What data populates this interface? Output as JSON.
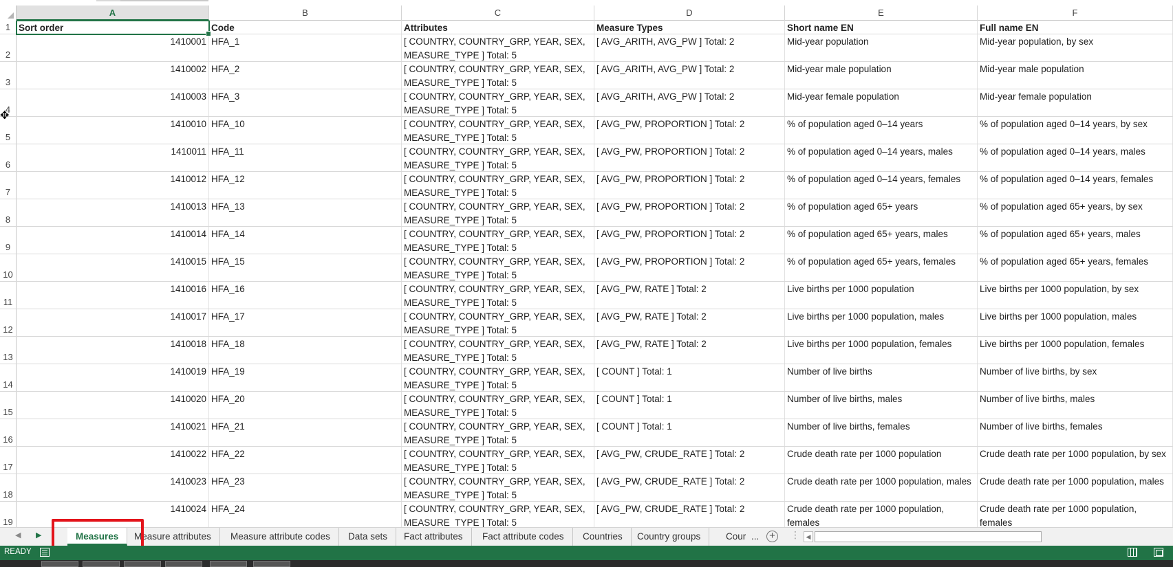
{
  "columns": [
    {
      "letter": "A",
      "selected": true
    },
    {
      "letter": "B",
      "selected": false
    },
    {
      "letter": "C",
      "selected": false
    },
    {
      "letter": "D",
      "selected": false
    },
    {
      "letter": "E",
      "selected": false
    },
    {
      "letter": "F",
      "selected": false
    }
  ],
  "header_row": {
    "num": "1",
    "cells": [
      "Sort order",
      "Code",
      "Attributes",
      "Measure Types",
      "Short name EN",
      "Full name EN"
    ]
  },
  "rows": [
    {
      "num": "2",
      "sort": "1410001",
      "code": "HFA_1",
      "attr": "[ COUNTRY, COUNTRY_GRP, YEAR, SEX, MEASURE_TYPE ] Total: 5",
      "types": "[ AVG_ARITH, AVG_PW ] Total: 2",
      "short": "Mid-year population",
      "full": "Mid-year population, by sex"
    },
    {
      "num": "3",
      "sort": "1410002",
      "code": "HFA_2",
      "attr": "[ COUNTRY, COUNTRY_GRP, YEAR, SEX, MEASURE_TYPE ] Total: 5",
      "types": "[ AVG_ARITH, AVG_PW ] Total: 2",
      "short": "Mid-year male population",
      "full": "Mid-year male population"
    },
    {
      "num": "4",
      "sort": "1410003",
      "code": "HFA_3",
      "attr": "[ COUNTRY, COUNTRY_GRP, YEAR, SEX, MEASURE_TYPE ] Total: 5",
      "types": "[ AVG_ARITH, AVG_PW ] Total: 2",
      "short": "Mid-year female population",
      "full": "Mid-year female population"
    },
    {
      "num": "5",
      "sort": "1410010",
      "code": "HFA_10",
      "attr": "[ COUNTRY, COUNTRY_GRP, YEAR, SEX, MEASURE_TYPE ] Total: 5",
      "types": "[ AVG_PW, PROPORTION ] Total: 2",
      "short": "% of population aged 0–14 years",
      "full": "% of population aged 0–14 years, by sex"
    },
    {
      "num": "6",
      "sort": "1410011",
      "code": "HFA_11",
      "attr": "[ COUNTRY, COUNTRY_GRP, YEAR, SEX, MEASURE_TYPE ] Total: 5",
      "types": "[ AVG_PW, PROPORTION ] Total: 2",
      "short": "% of population aged 0–14 years, males",
      "full": "% of population aged 0–14 years, males"
    },
    {
      "num": "7",
      "sort": "1410012",
      "code": "HFA_12",
      "attr": "[ COUNTRY, COUNTRY_GRP, YEAR, SEX, MEASURE_TYPE ] Total: 5",
      "types": "[ AVG_PW, PROPORTION ] Total: 2",
      "short": "% of population aged 0–14 years, females",
      "full": "% of population aged 0–14 years, females"
    },
    {
      "num": "8",
      "sort": "1410013",
      "code": "HFA_13",
      "attr": "[ COUNTRY, COUNTRY_GRP, YEAR, SEX, MEASURE_TYPE ] Total: 5",
      "types": "[ AVG_PW, PROPORTION ] Total: 2",
      "short": "% of population aged 65+ years",
      "full": "% of population aged 65+ years, by sex"
    },
    {
      "num": "9",
      "sort": "1410014",
      "code": "HFA_14",
      "attr": "[ COUNTRY, COUNTRY_GRP, YEAR, SEX, MEASURE_TYPE ] Total: 5",
      "types": "[ AVG_PW, PROPORTION ] Total: 2",
      "short": "% of population aged 65+ years, males",
      "full": "% of population aged 65+ years, males"
    },
    {
      "num": "10",
      "sort": "1410015",
      "code": "HFA_15",
      "attr": "[ COUNTRY, COUNTRY_GRP, YEAR, SEX, MEASURE_TYPE ] Total: 5",
      "types": "[ AVG_PW, PROPORTION ] Total: 2",
      "short": "% of population aged 65+ years, females",
      "full": "% of population aged 65+ years, females"
    },
    {
      "num": "11",
      "sort": "1410016",
      "code": "HFA_16",
      "attr": "[ COUNTRY, COUNTRY_GRP, YEAR, SEX, MEASURE_TYPE ] Total: 5",
      "types": "[ AVG_PW, RATE ] Total: 2",
      "short": "Live births per 1000 population",
      "full": "Live births per 1000 population, by sex"
    },
    {
      "num": "12",
      "sort": "1410017",
      "code": "HFA_17",
      "attr": "[ COUNTRY, COUNTRY_GRP, YEAR, SEX, MEASURE_TYPE ] Total: 5",
      "types": "[ AVG_PW, RATE ] Total: 2",
      "short": "Live births per 1000 population, males",
      "full": "Live births per 1000 population, males"
    },
    {
      "num": "13",
      "sort": "1410018",
      "code": "HFA_18",
      "attr": "[ COUNTRY, COUNTRY_GRP, YEAR, SEX, MEASURE_TYPE ] Total: 5",
      "types": "[ AVG_PW, RATE ] Total: 2",
      "short": "Live births per 1000 population, females",
      "full": "Live births per 1000 population, females"
    },
    {
      "num": "14",
      "sort": "1410019",
      "code": "HFA_19",
      "attr": "[ COUNTRY, COUNTRY_GRP, YEAR, SEX, MEASURE_TYPE ] Total: 5",
      "types": "[ COUNT ] Total: 1",
      "short": "Number of live births",
      "full": "Number of live births, by sex"
    },
    {
      "num": "15",
      "sort": "1410020",
      "code": "HFA_20",
      "attr": "[ COUNTRY, COUNTRY_GRP, YEAR, SEX, MEASURE_TYPE ] Total: 5",
      "types": "[ COUNT ] Total: 1",
      "short": "Number of live births, males",
      "full": "Number of live births, males"
    },
    {
      "num": "16",
      "sort": "1410021",
      "code": "HFA_21",
      "attr": "[ COUNTRY, COUNTRY_GRP, YEAR, SEX, MEASURE_TYPE ] Total: 5",
      "types": "[ COUNT ] Total: 1",
      "short": "Number of live births, females",
      "full": "Number of live births, females"
    },
    {
      "num": "17",
      "sort": "1410022",
      "code": "HFA_22",
      "attr": "[ COUNTRY, COUNTRY_GRP, YEAR, SEX, MEASURE_TYPE ] Total: 5",
      "types": "[ AVG_PW, CRUDE_RATE ] Total: 2",
      "short": "Crude death rate per 1000 population",
      "full": "Crude death rate per 1000 population, by sex"
    },
    {
      "num": "18",
      "sort": "1410023",
      "code": "HFA_23",
      "attr": "[ COUNTRY, COUNTRY_GRP, YEAR, SEX, MEASURE_TYPE ] Total: 5",
      "types": "[ AVG_PW, CRUDE_RATE ] Total: 2",
      "short": "Crude death rate per 1000 population, males",
      "full": "Crude death rate per 1000 population, males"
    },
    {
      "num": "19",
      "sort": "1410024",
      "code": "HFA_24",
      "attr": "[ COUNTRY, COUNTRY_GRP, YEAR, SEX, MEASURE_TYPE ] Total: 5",
      "types": "[ AVG_PW, CRUDE_RATE ] Total: 2",
      "short": "Crude death rate per 1000 population, females",
      "full": "Crude death rate per 1000 population, females"
    }
  ],
  "sheet_tabs": [
    {
      "label": "Measures",
      "active": true
    },
    {
      "label": "Measure attributes",
      "active": false
    },
    {
      "label": "Measure attribute codes",
      "active": false
    },
    {
      "label": "Data sets",
      "active": false
    },
    {
      "label": "Fact attributes",
      "active": false
    },
    {
      "label": "Fact attribute codes",
      "active": false
    },
    {
      "label": "Countries",
      "active": false
    },
    {
      "label": "Country groups",
      "active": false
    }
  ],
  "truncated_tab": "Cour",
  "ellipsis": "...",
  "status": {
    "ready": "READY"
  },
  "colors": {
    "accent": "#217346",
    "highlight": "#e3141b"
  },
  "icons": {
    "scroll_left": "triangle-left-icon",
    "scroll_right": "triangle-right-icon",
    "add_sheet": "plus-circle-icon",
    "normal_view": "grid-view-icon",
    "page_layout": "page-layout-icon",
    "macro": "macro-record-icon"
  }
}
